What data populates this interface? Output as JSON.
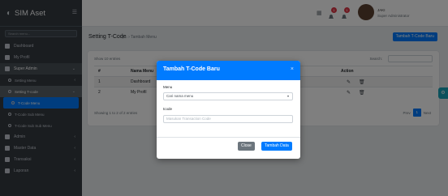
{
  "brand": {
    "title": "SIM Aset",
    "collapse_icon": "menu-toggle-icon"
  },
  "sidebar": {
    "search_placeholder": "Search menu...",
    "items": [
      {
        "label": "Dashboard"
      },
      {
        "label": "My Profil"
      },
      {
        "label": "Super Admin"
      },
      {
        "label": "Setting Menu"
      },
      {
        "label": "Setting T-code"
      },
      {
        "label": "T-Code Menu"
      },
      {
        "label": "T-Code Sub Menu"
      },
      {
        "label": "T-Code Sub Sub Menu"
      },
      {
        "label": "Admin"
      },
      {
        "label": "Master Data"
      },
      {
        "label": "Transaksi"
      },
      {
        "label": "Laporan"
      }
    ]
  },
  "topbar": {
    "badge1": "1",
    "badge2": "1",
    "user_name": "JAKI",
    "user_role": "Super Administrator"
  },
  "header": {
    "title": "Setting T-Code",
    "breadcrumb": "Tambah Menu",
    "add_button": "Tambah T-Code Baru"
  },
  "table": {
    "show_label": "Show 10 entries",
    "search_label": "Search:",
    "columns": [
      "#",
      "Nama Menu",
      "Action"
    ],
    "rows": [
      {
        "no": "1",
        "name": "Dashboard"
      },
      {
        "no": "2",
        "name": "My Profil"
      }
    ],
    "info": "Showing 1 to 2 of 2 entries",
    "prev": "Prev",
    "page": "1",
    "next": "Next"
  },
  "modal": {
    "title": "Tambah T-Code Baru",
    "close_icon": "×",
    "menu_label": "Menu",
    "menu_value": "Cari nama menu",
    "tcode_label": "tcode",
    "tcode_placeholder": "Masukan Transaction Code",
    "close_button": "Close",
    "save_button": "Tambah Data"
  },
  "colors": {
    "primary": "#007bff",
    "sidebar": "#343a40",
    "secondary": "#6c757d",
    "danger": "#dc3545"
  }
}
